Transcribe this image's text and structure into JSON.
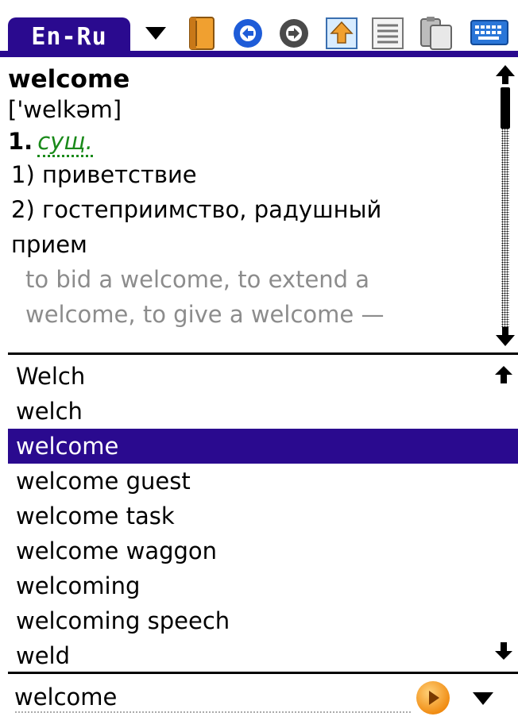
{
  "toolbar": {
    "language_pair": "En-Ru",
    "icons": [
      "chevron-down-icon",
      "book-icon",
      "back-arrow-icon",
      "forward-arrow-icon",
      "upload-icon",
      "list-icon",
      "clipboard-icon",
      "keyboard-icon"
    ],
    "accent_color": "#2a0a8f"
  },
  "entry": {
    "headword": "welcome",
    "transcription": "['welkəm]",
    "sense_number": "1.",
    "part_of_speech": "сущ.",
    "meanings": [
      "1) приветствие",
      "2) гостеприимство, радушный",
      "прием"
    ],
    "examples": [
      "to bid a welcome, to extend a",
      "welcome, to give a welcome —"
    ],
    "pos_color": "#1a8a1a",
    "example_color": "#8c8c8c"
  },
  "wordlist": {
    "items": [
      "Welch",
      "welch",
      "welcome",
      "welcome guest",
      "welcome task",
      "welcome waggon",
      "welcoming",
      "welcoming speech",
      "weld"
    ],
    "selected": "welcome"
  },
  "search": {
    "value": "welcome"
  }
}
